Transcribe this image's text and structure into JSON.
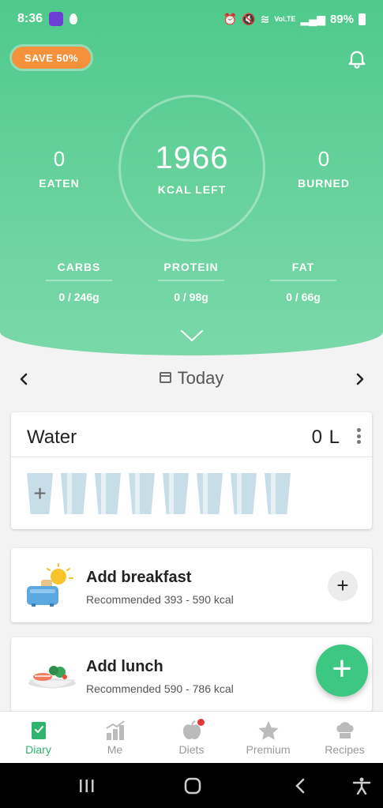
{
  "status_bar": {
    "time": "8:36",
    "network": "VoLTE",
    "battery": "89%"
  },
  "promo": {
    "label": "SAVE 50%"
  },
  "summary": {
    "eaten_value": "0",
    "eaten_label": "EATEN",
    "kcal_left_value": "1966",
    "kcal_left_label": "KCAL LEFT",
    "burned_value": "0",
    "burned_label": "BURNED"
  },
  "macros": [
    {
      "label": "CARBS",
      "value": "0 / 246g"
    },
    {
      "label": "PROTEIN",
      "value": "0 / 98g"
    },
    {
      "label": "FAT",
      "value": "0 / 66g"
    }
  ],
  "date_nav": {
    "label": "Today"
  },
  "water": {
    "title": "Water",
    "value": "0 L",
    "glasses_total": 8,
    "glasses_filled": 0
  },
  "meals": [
    {
      "title": "Add breakfast",
      "subtitle": "Recommended 393 - 590 kcal"
    },
    {
      "title": "Add lunch",
      "subtitle": "Recommended 590 - 786 kcal"
    }
  ],
  "nav": [
    {
      "label": "Diary",
      "icon": "diary-icon",
      "active": true
    },
    {
      "label": "Me",
      "icon": "chart-icon",
      "active": false
    },
    {
      "label": "Diets",
      "icon": "apple-icon",
      "active": false
    },
    {
      "label": "Premium",
      "icon": "star-icon",
      "active": false
    },
    {
      "label": "Recipes",
      "icon": "chef-hat-icon",
      "active": false
    }
  ],
  "colors": {
    "brand_green": "#4fc98c",
    "promo_orange": "#f5913b",
    "fab_green": "#3cc783",
    "active_nav": "#2fb36f"
  }
}
